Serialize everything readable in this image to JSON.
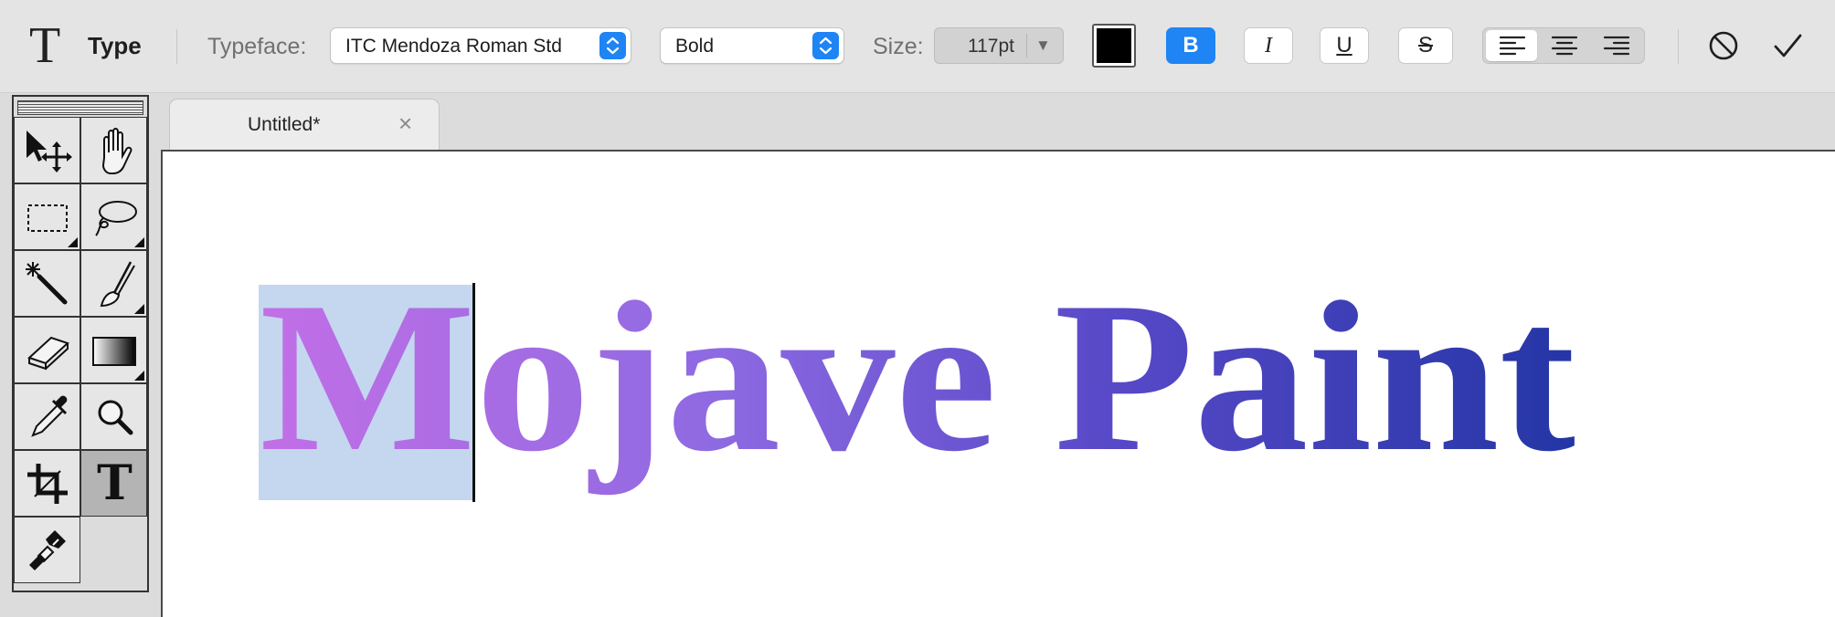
{
  "tool_options": {
    "tool_glyph": "T",
    "tool_name": "Type",
    "typeface_label": "Typeface:",
    "typeface_value": "ITC Mendoza Roman Std",
    "style_value": "Bold",
    "size_label": "Size:",
    "size_value": "117pt",
    "text_color": "#000000",
    "format_buttons": {
      "bold": "B",
      "italic": "I",
      "underline": "U",
      "strike": "S"
    },
    "bold_active": true,
    "alignment": "left",
    "accent_color": "#1f84f4"
  },
  "toolbox": {
    "tools": [
      {
        "name": "move-tool",
        "icon": "move-arrow-icon"
      },
      {
        "name": "hand-tool",
        "icon": "hand-icon"
      },
      {
        "name": "rectangular-marquee-tool",
        "icon": "marquee-icon"
      },
      {
        "name": "lasso-tool",
        "icon": "lasso-icon"
      },
      {
        "name": "magic-wand-tool",
        "icon": "magic-wand-icon"
      },
      {
        "name": "brush-tool",
        "icon": "brush-icon"
      },
      {
        "name": "eraser-tool",
        "icon": "eraser-icon"
      },
      {
        "name": "gradient-tool",
        "icon": "gradient-icon"
      },
      {
        "name": "eyedropper-tool",
        "icon": "eyedropper-icon"
      },
      {
        "name": "zoom-tool",
        "icon": "magnifier-icon"
      },
      {
        "name": "crop-tool",
        "icon": "crop-icon"
      },
      {
        "name": "type-tool",
        "icon": "type-icon",
        "selected": true
      },
      {
        "name": "clone-stamp-tool",
        "icon": "clone-stamp-icon"
      }
    ],
    "type_tool_glyph": "T"
  },
  "document": {
    "tab_title": "Untitled",
    "tab_modified_mark": "*",
    "tab_close": "×",
    "canvas_text": "Mojave Paint",
    "text_gradient": [
      "#c36fe6",
      "#8e6ae2",
      "#5849c8",
      "#2536a6"
    ],
    "selection_color": "#c4d7ef"
  }
}
